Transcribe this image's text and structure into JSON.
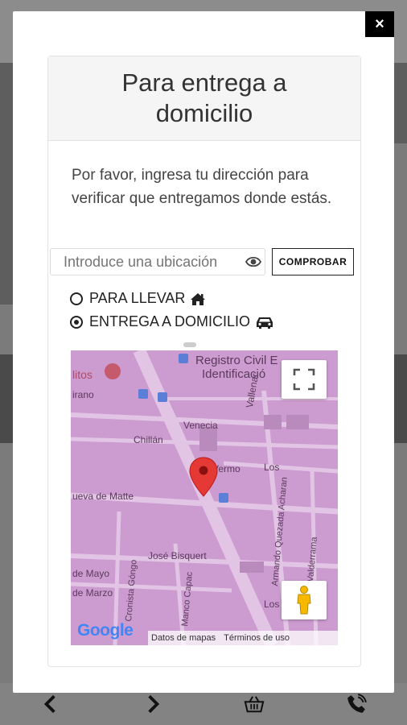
{
  "modal": {
    "close_label": "×",
    "title": "Para entrega a domicilio",
    "description": "Por favor, ingresa tu dirección para verificar que entregamos donde estás.",
    "search": {
      "placeholder": "Introduce una ubicación",
      "value": ""
    },
    "check_button": "COMPROBAR",
    "options": [
      {
        "label": "PARA LLEVAR",
        "selected": false,
        "icon": "home-icon"
      },
      {
        "label": "ENTREGA A DOMICILIO",
        "selected": true,
        "icon": "car-icon"
      }
    ]
  },
  "map": {
    "labels": [
      "Registro Civil E",
      "Identificació",
      "litos",
      "irano",
      "Venecia",
      "Vallenar",
      "Chillán",
      "Vermo",
      "ueva de Matte",
      "Los",
      "Armando Quezada Acharan",
      "Luis Valderrama",
      "José Bisquert",
      "de Mayo",
      "de Marzo",
      "Cronista Góngo",
      "Manco Capac",
      "Los"
    ],
    "logo": "Google",
    "attribution": [
      "Datos de mapas",
      "Términos de uso"
    ],
    "fullscreen_icon": "fullscreen-icon",
    "pegman_icon": "pegman-icon",
    "marker_icon": "location-pin-icon"
  },
  "bottom_nav": [
    {
      "icon": "chevron-left-icon"
    },
    {
      "icon": "chevron-right-icon"
    },
    {
      "icon": "basket-icon"
    },
    {
      "icon": "phone-icon"
    }
  ],
  "colors": {
    "map_bg": "#cc9bd0",
    "marker": "#e53935",
    "overlay": "#7b7b7b"
  }
}
